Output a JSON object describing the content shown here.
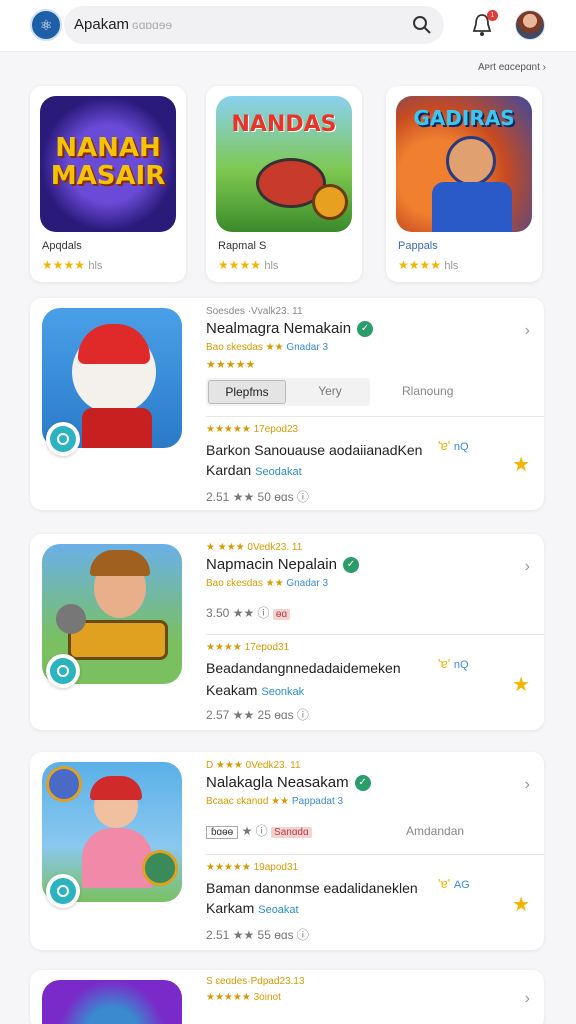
{
  "header": {
    "search_value": "Apakam",
    "search_placeholder": "ɢɑɒɑɘɘ",
    "notification_count": "1",
    "see_all": "Aᴘrt eɑcepɑnt ›"
  },
  "featured": [
    {
      "art": "NANAH MASAIR",
      "name": "Apqdals",
      "stars": "★★★★",
      "tail": "hls",
      "on": 4
    },
    {
      "art": "NANDAS",
      "name": "Rapmal S",
      "stars": "★★★★",
      "tail": "hls",
      "on": 3
    },
    {
      "art": "GADIRAS",
      "name": "Pappals",
      "stars": "★★★★",
      "tail": "hls",
      "on": 3
    }
  ],
  "apps": [
    {
      "meta": "Soesdes ·Vvalk23. 11",
      "title": "Nealmagra Nemakain",
      "sub_rating": "Bao ɛkesdas ★★",
      "sub_blue": "Gnadar 3",
      "sub_stars": "★★★★★",
      "tab_on": "Plepfms",
      "tab_off": "Yery",
      "tab_right": "Rlanoung",
      "review_meta": "★★★★★ 17epod23",
      "review_body": "Barkon Sanouause aodaiianadKen",
      "review_name": "Kardan",
      "review_name_blue": "Seodakat",
      "emoji": "'ɐ'",
      "emoji_text": "nQ",
      "foot": "2.51 ★★ 50 ɵɑs ⓘ"
    },
    {
      "meta": "★ ★★★ 0Vedk23. 11",
      "title": "Napmacin Nepalain",
      "sub_rating": "Bao ɛkesdas ★★",
      "sub_blue": "Gnadar 3",
      "row3": "3.50 ★★ ⓘ",
      "row3_pill": "ɵɑ",
      "review_meta": "★★★★ 17epod31",
      "review_body": "Beadandangnnedadaidemeken",
      "review_name": "Keakam",
      "review_name_blue": "Seonkak",
      "emoji": "'ɐ'",
      "emoji_text": "nQ",
      "foot": "2.57 ★★ 25 ɵɑs ⓘ"
    },
    {
      "meta": "D ★★★ 0Vedk23. 11",
      "title": "Nalakagla Neasakam",
      "sub_rating": "Bcaac ɛkanɑd ★★",
      "sub_blue": "Pappadat 3",
      "row3_box": "ɓɑɵɵ",
      "row3": "★ ⓘ",
      "row3_pill": "Sanɑdɑ",
      "tab_right": "Amdandan",
      "review_meta": "★★★★★ 19apod31",
      "review_body": "Baman danonmse eadalidaneklen",
      "review_name": "Karkam",
      "review_name_blue": "Seoakat",
      "emoji": "'ɐ'",
      "emoji_text": "AG",
      "foot": "2.51 ★★ 55 ɵɑs ⓘ"
    },
    {
      "meta": "S ɛeɑdes·Pdpad23.13",
      "sub_stars": "★★★★★ 3oinot"
    }
  ],
  "colors": {
    "accent": "#f5b400",
    "verified": "#2a9d6a",
    "badge": "#2bb3c0"
  }
}
